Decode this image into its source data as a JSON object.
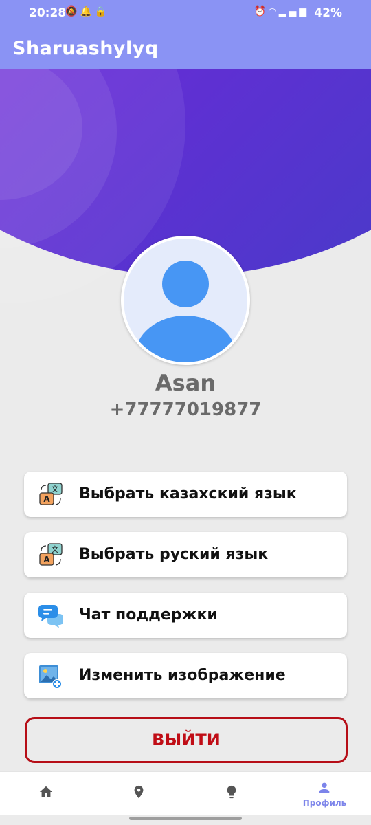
{
  "status_bar": {
    "time": "20:28",
    "battery": "42%"
  },
  "app_bar": {
    "title": "Sharuashylyq"
  },
  "profile": {
    "name": "Asan",
    "phone": "+77777019877"
  },
  "menu": [
    {
      "label": "Выбрать казахский язык",
      "icon": "translate-icon"
    },
    {
      "label": "Выбрать руский язык",
      "icon": "translate-icon"
    },
    {
      "label": "Чат поддержки",
      "icon": "chat-icon"
    },
    {
      "label": "Изменить изображение",
      "icon": "image-add-icon"
    }
  ],
  "logout_label": "ВЫЙТИ",
  "bottom_nav": {
    "items": [
      {
        "icon": "home-icon"
      },
      {
        "icon": "location-pin-icon"
      },
      {
        "icon": "lightbulb-icon"
      },
      {
        "icon": "person-icon",
        "label": "Профиль",
        "active": true
      }
    ]
  },
  "colors": {
    "app_bar": "#8a93f4",
    "gradient_start": "#8447e8",
    "gradient_end": "#3f3fc4",
    "logout": "#c00d16",
    "active_nav": "#7c84ea"
  }
}
